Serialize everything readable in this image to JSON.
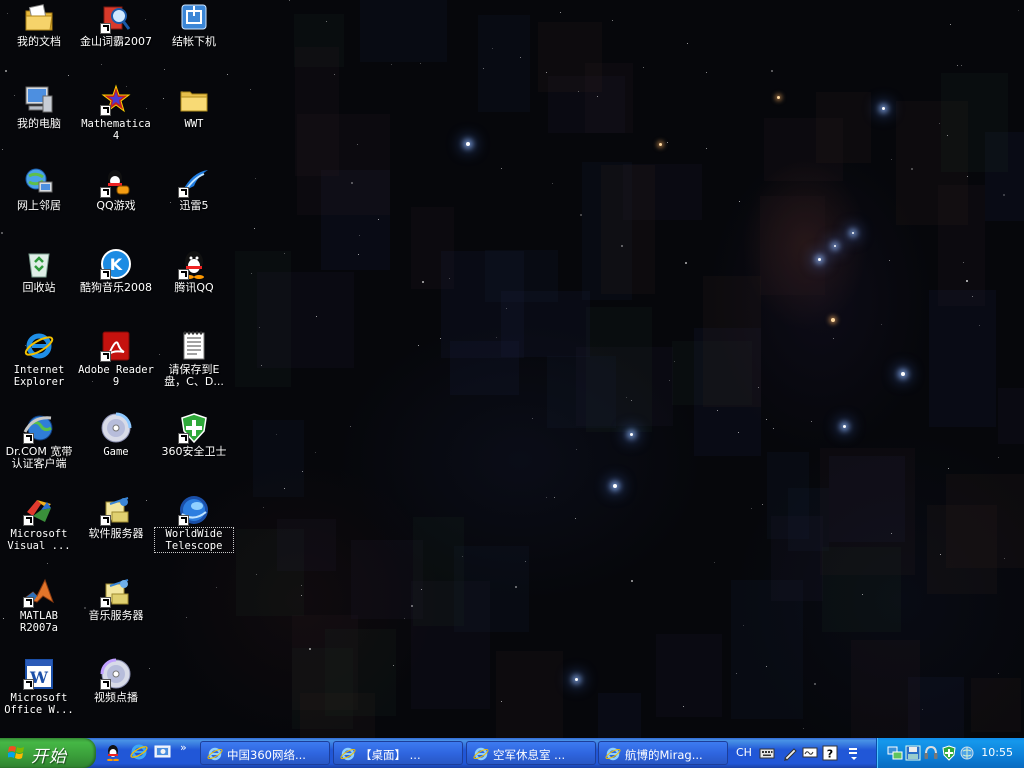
{
  "desktop": {
    "icons": [
      {
        "label": "我的文档",
        "icon": "my-documents-icon"
      },
      {
        "label": "金山词霸2007",
        "icon": "kingsoft-dictionary-icon"
      },
      {
        "label": "结帐下机",
        "icon": "checkout-logoff-icon"
      },
      {
        "label": "我的电脑",
        "icon": "my-computer-icon"
      },
      {
        "label": "Mathematica\n4",
        "icon": "mathematica-icon"
      },
      {
        "label": "WWT",
        "icon": "folder-icon"
      },
      {
        "label": "网上邻居",
        "icon": "network-places-icon"
      },
      {
        "label": "QQ游戏",
        "icon": "qq-game-icon"
      },
      {
        "label": "迅雷5",
        "icon": "thunder-icon"
      },
      {
        "label": "回收站",
        "icon": "recycle-bin-icon"
      },
      {
        "label": "酷狗音乐2008",
        "icon": "kugou-music-icon"
      },
      {
        "label": "腾讯QQ",
        "icon": "qq-penguin-icon"
      },
      {
        "label": "Internet\nExplorer",
        "icon": "internet-explorer-icon"
      },
      {
        "label": "Adobe Reader\n9",
        "icon": "adobe-reader-icon"
      },
      {
        "label": "请保存到E\n盘，C、D...",
        "icon": "text-document-icon"
      },
      {
        "label": "Dr.COM 宽带\n认证客户端",
        "icon": "drcom-globe-icon"
      },
      {
        "label": "Game",
        "icon": "game-disc-icon"
      },
      {
        "label": "360安全卫士",
        "icon": "360-shield-icon"
      },
      {
        "label": "Microsoft\nVisual ...",
        "icon": "visual-studio-icon"
      },
      {
        "label": "软件服务器",
        "icon": "software-server-icon"
      },
      {
        "label": "WorldWide\nTelescope",
        "icon": "worldwide-telescope-icon"
      },
      {
        "label": "MATLAB\nR2007a",
        "icon": "matlab-icon"
      },
      {
        "label": "音乐服务器",
        "icon": "music-server-icon"
      },
      {
        "label": "Microsoft\nOffice W...",
        "icon": "word-icon"
      },
      {
        "label": "视频点播",
        "icon": "video-on-demand-icon"
      }
    ]
  },
  "taskbar": {
    "start_label": "开始",
    "quicklaunch": [
      "qq-icon",
      "internet-explorer-icon",
      "show-desktop-icon"
    ],
    "quicklaunch_more": "»",
    "tasks": [
      {
        "label": "中国360网络...",
        "icon": "ie-window-icon"
      },
      {
        "label": "【桌面】 ...",
        "icon": "ie-window-icon"
      },
      {
        "label": "空军休息室 ...",
        "icon": "ie-window-icon"
      },
      {
        "label": "航博的Mirag...",
        "icon": "ie-window-icon"
      }
    ],
    "language": "CH",
    "language_bar_icons": [
      "keyboard-icon",
      "pen-icon",
      "handwriting-icon",
      "help-icon",
      "options-icon"
    ],
    "tray_icons": [
      "network-icon",
      "save-icon",
      "headset-icon",
      "shield-icon",
      "network-connection-icon"
    ],
    "clock": "10:55"
  },
  "colors": {
    "taskbar_blue": "#2157d7",
    "start_green": "#3a9e3a",
    "tray_blue": "#0c7fd8"
  }
}
